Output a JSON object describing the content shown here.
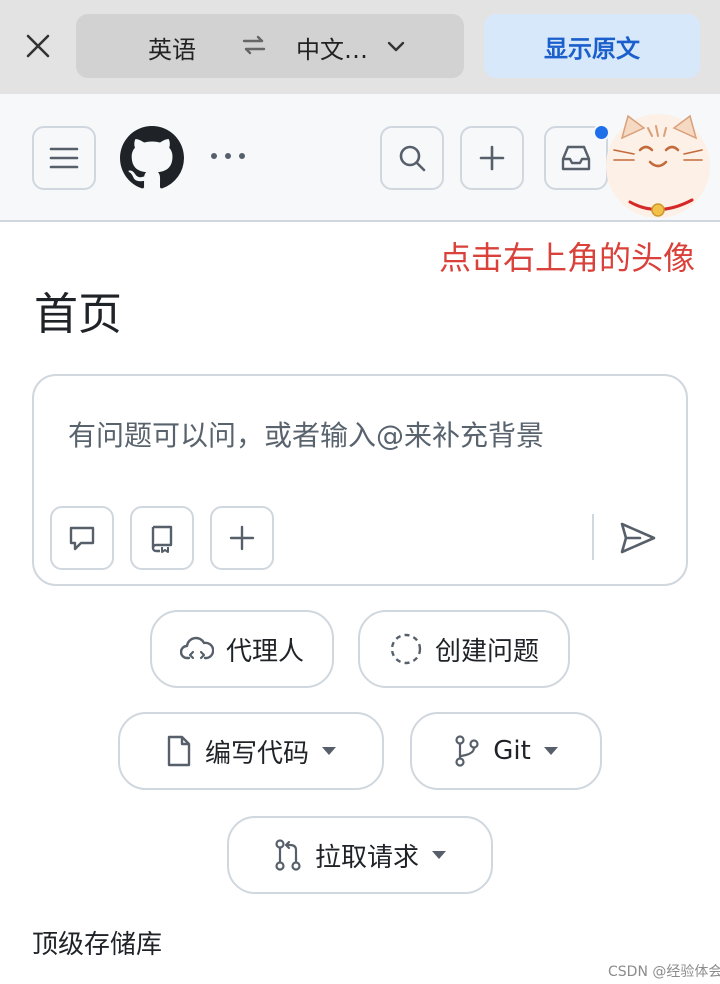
{
  "translate_bar": {
    "source_lang": "英语",
    "target_lang": "中文…",
    "show_original_label": "显示原文"
  },
  "header": {
    "logo": "github-logo-icon",
    "icons": [
      "menu-icon",
      "search-icon",
      "plus-icon",
      "inbox-icon",
      "more-icon"
    ],
    "notification_color": "#1f6feb"
  },
  "annotation": "点击右上角的头像",
  "page_title": "首页",
  "prompt": {
    "placeholder": "有问题可以问，或者输入@来补充背景"
  },
  "actions": {
    "agent": "代理人",
    "create_issue": "创建问题",
    "write_code": "编写代码",
    "git": "Git",
    "pull_request": "拉取请求"
  },
  "section_title": "顶级存储库",
  "watermark": "CSDN @经验体会",
  "colors": {
    "annotation": "#d9413a",
    "show_original_text": "#1a5fcc",
    "show_original_bg": "#d8e8fb"
  }
}
